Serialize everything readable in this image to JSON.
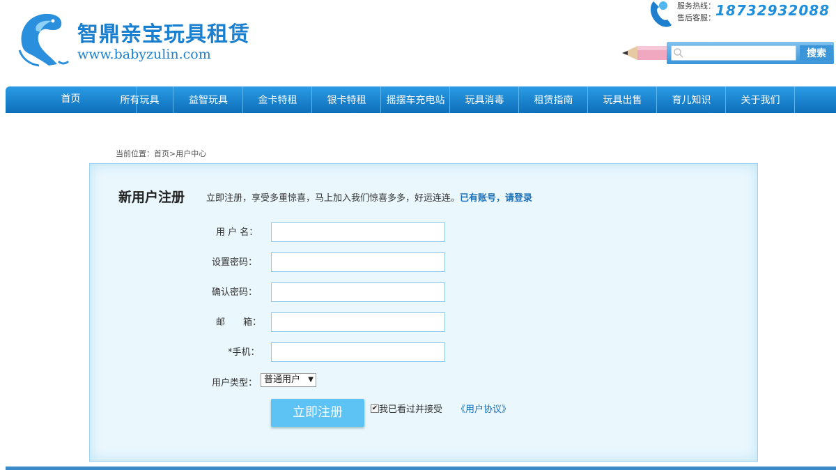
{
  "header": {
    "brand_name": "智鼎亲宝玩具租赁",
    "brand_url": "www.babyzulin.com",
    "hotline_label_1": "服务热线：",
    "hotline_label_2": "售后客服：",
    "hotline_number": "18732932088",
    "search_placeholder": "",
    "search_button": "搜索"
  },
  "nav": {
    "items": [
      {
        "label": "首页"
      },
      {
        "label": "所有玩具"
      },
      {
        "label": "益智玩具"
      },
      {
        "label": "金卡特租"
      },
      {
        "label": "银卡特租"
      },
      {
        "label": "摇摆车充电站"
      },
      {
        "label": "玩具消毒"
      },
      {
        "label": "租赁指南"
      },
      {
        "label": "玩具出售"
      },
      {
        "label": "育儿知识"
      },
      {
        "label": "关于我们"
      }
    ]
  },
  "breadcrumb": "当前位置：首页>用户中心",
  "form": {
    "title": "新用户注册",
    "intro": "立即注册，享受多重惊喜，马上加入我们惊喜多多，好运连连。",
    "login_link": "已有账号，请登录",
    "fields": [
      {
        "label": "用 户 名：",
        "value": ""
      },
      {
        "label": "设置密码：",
        "value": ""
      },
      {
        "label": "确认密码：",
        "value": ""
      },
      {
        "label": "邮　　箱：",
        "value": ""
      },
      {
        "label": "*手机：",
        "value": ""
      }
    ],
    "user_type_label": "用户类型：",
    "user_type_selected": "普通用户",
    "submit_label": "立即注册",
    "agree_checked": true,
    "agree_text": "我已看过并接受",
    "agreement_link": "《用户协议》"
  },
  "colors": {
    "brand": "#1a7fcf",
    "nav": "#1684d0",
    "submit": "#5cc3f4",
    "panel": "#eaf7fd"
  }
}
